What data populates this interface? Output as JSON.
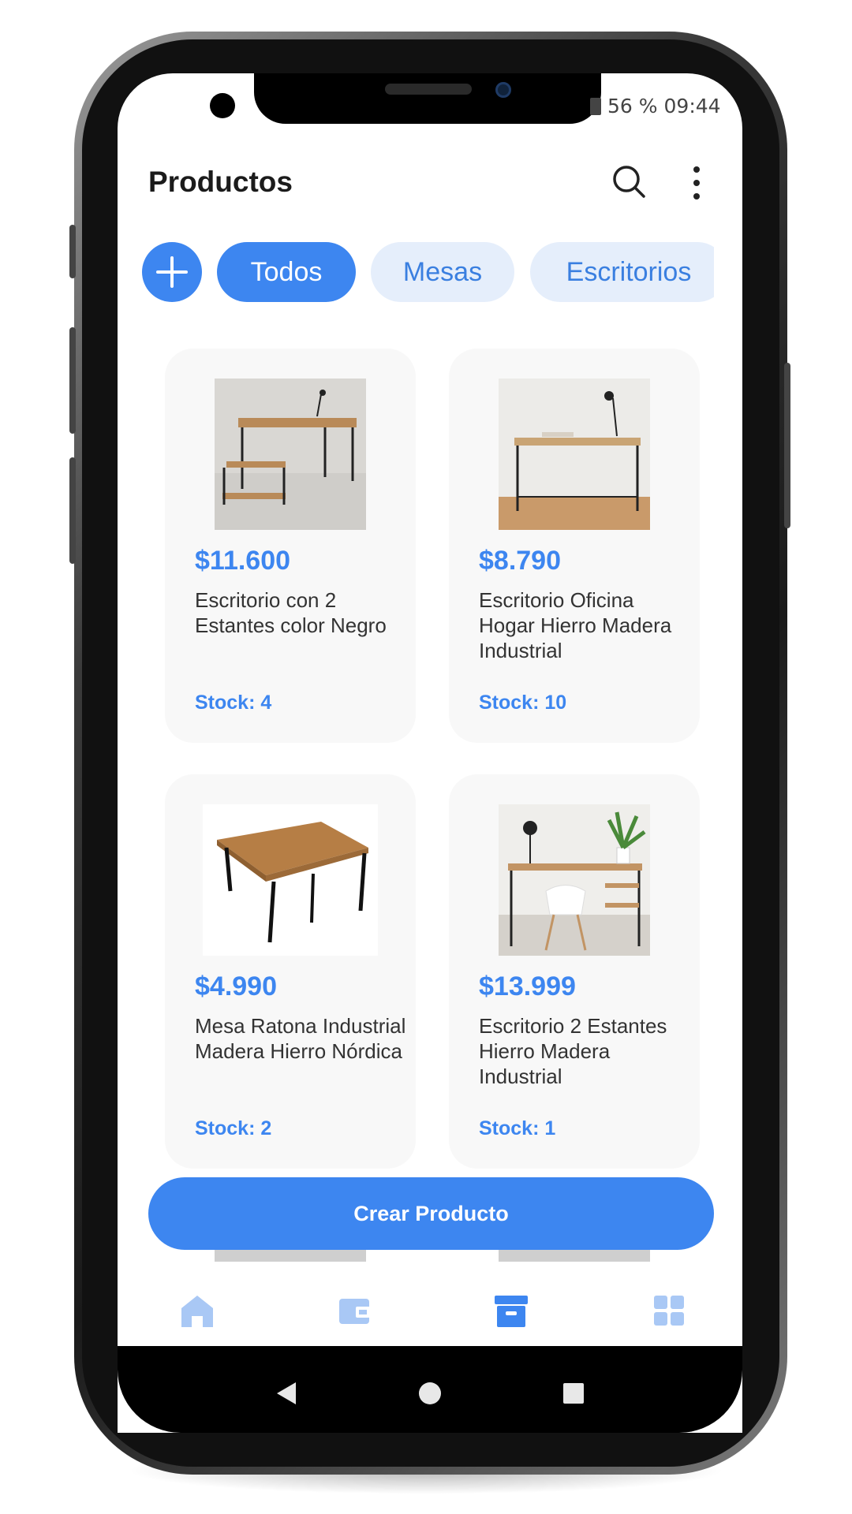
{
  "status_bar": {
    "battery": "56 %",
    "time": "09:44"
  },
  "app_bar": {
    "title": "Productos",
    "search_icon": "search-icon",
    "more_icon": "more-vertical-icon"
  },
  "filters": {
    "add_icon": "plus-icon",
    "chips": [
      {
        "label": "Todos",
        "active": true
      },
      {
        "label": "Mesas",
        "active": false
      },
      {
        "label": "Escritorios",
        "active": false
      }
    ]
  },
  "products": [
    {
      "price": "$11.600",
      "name": "Escritorio con 2 Estantes color Negro",
      "stock": "Stock: 4"
    },
    {
      "price": "$8.790",
      "name": "Escritorio Oficina Hogar Hierro Madera Industrial",
      "stock": "Stock: 10"
    },
    {
      "price": "$4.990",
      "name": "Mesa Ratona Industrial Madera Hierro Nórdica",
      "stock": "Stock: 2"
    },
    {
      "price": "$13.999",
      "name": "Escritorio 2 Estantes Hierro Madera Industrial",
      "stock": "Stock: 1"
    }
  ],
  "create_button": {
    "label": "Crear Producto"
  },
  "bottom_nav": [
    {
      "icon": "home-icon",
      "active": false
    },
    {
      "icon": "wallet-icon",
      "active": false
    },
    {
      "icon": "archive-box-icon",
      "active": true
    },
    {
      "icon": "grid-icon",
      "active": false
    }
  ],
  "system_nav": [
    "back-icon",
    "home-circle-icon",
    "recents-icon"
  ],
  "colors": {
    "accent": "#3d86f0",
    "chip_inactive_bg": "#e5eefb",
    "card_bg": "#f8f8f8",
    "nav_inactive": "#a9c8f5"
  }
}
